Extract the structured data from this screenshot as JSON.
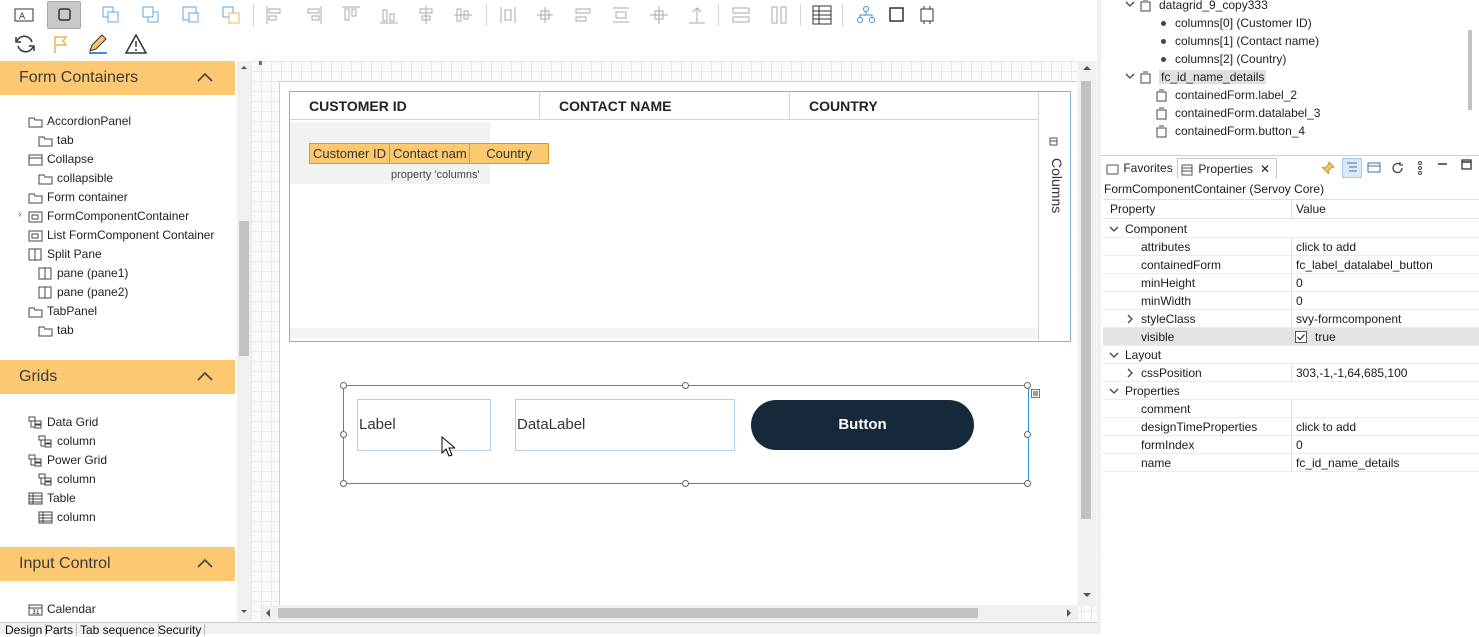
{
  "palette": {
    "categories": [
      {
        "title": "Form Containers",
        "items": [
          {
            "label": "AccordionPanel",
            "icon": "folder-icon",
            "level": 0
          },
          {
            "label": "tab",
            "icon": "folder-icon",
            "level": 1
          },
          {
            "label": "Collapse",
            "icon": "collapse-icon",
            "level": 0
          },
          {
            "label": "collapsible",
            "icon": "folder-icon",
            "level": 1
          },
          {
            "label": "Form container",
            "icon": "folder-icon",
            "level": 0
          },
          {
            "label": "FormComponentContainer",
            "icon": "formcomponent-icon",
            "level": 0
          },
          {
            "label": "List FormComponent Container",
            "icon": "formcomponent-icon",
            "level": 0
          },
          {
            "label": "Split Pane",
            "icon": "splitpane-icon",
            "level": 0
          },
          {
            "label": "pane (pane1)",
            "icon": "splitpane-icon",
            "level": 1
          },
          {
            "label": "pane (pane2)",
            "icon": "splitpane-icon",
            "level": 1
          },
          {
            "label": "TabPanel",
            "icon": "folder-icon",
            "level": 0
          },
          {
            "label": "tab",
            "icon": "folder-icon",
            "level": 1
          }
        ]
      },
      {
        "title": "Grids",
        "items": [
          {
            "label": "Data Grid",
            "icon": "datagrid-icon",
            "level": 0
          },
          {
            "label": "column",
            "icon": "datagrid-icon",
            "level": 1
          },
          {
            "label": "Power Grid",
            "icon": "datagrid-icon",
            "level": 0
          },
          {
            "label": "column",
            "icon": "datagrid-icon",
            "level": 1
          },
          {
            "label": "Table",
            "icon": "table-icon",
            "level": 0
          },
          {
            "label": "column",
            "icon": "table-icon",
            "level": 1
          }
        ]
      },
      {
        "title": "Input Control",
        "items": [
          {
            "label": "Calendar",
            "icon": "calendar-icon",
            "level": 0
          }
        ]
      }
    ]
  },
  "editor": {
    "grid": {
      "columns": [
        "CUSTOMER ID",
        "CONTACT NAME",
        "COUNTRY"
      ],
      "chips": [
        "Customer ID",
        "Contact nam",
        "Country"
      ],
      "property_label": "property 'columns'",
      "side_label": "Columns"
    },
    "form_component": {
      "label": "Label",
      "datalabel": "DataLabel",
      "button": "Button"
    }
  },
  "bottom_tabs": [
    "Design",
    "Parts",
    "Tab sequence",
    "Security"
  ],
  "outline": {
    "items": [
      {
        "label": "datagrid_9_copy333",
        "level": 1,
        "expanded": true,
        "icon": "component-icon"
      },
      {
        "label": "columns[0] (Customer ID)",
        "level": 2,
        "icon": "bullet-icon"
      },
      {
        "label": "columns[1] (Contact name)",
        "level": 2,
        "icon": "bullet-icon"
      },
      {
        "label": "columns[2] (Country)",
        "level": 2,
        "icon": "bullet-icon"
      },
      {
        "label": "fc_id_name_details",
        "level": 1,
        "expanded": true,
        "selected": true,
        "icon": "component-icon"
      },
      {
        "label": "containedForm.label_2",
        "level": 2,
        "icon": "component-icon"
      },
      {
        "label": "containedForm.datalabel_3",
        "level": 2,
        "icon": "component-icon"
      },
      {
        "label": "containedForm.button_4",
        "level": 2,
        "icon": "component-icon"
      }
    ]
  },
  "properties": {
    "tabs": [
      "Favorites",
      "Properties"
    ],
    "subtitle": "FormComponentContainer (Servoy Core)",
    "header": {
      "key": "Property",
      "value": "Value"
    },
    "rows": [
      {
        "key": "Component",
        "value": "",
        "group": true
      },
      {
        "key": "attributes",
        "value": "click to add"
      },
      {
        "key": "containedForm",
        "value": "fc_label_datalabel_button"
      },
      {
        "key": "minHeight",
        "value": "0"
      },
      {
        "key": "minWidth",
        "value": "0"
      },
      {
        "key": "styleClass",
        "value": "svy-formcomponent",
        "expandable": true
      },
      {
        "key": "visible",
        "value": "true",
        "checkbox": true,
        "highlight": true
      },
      {
        "key": "Layout",
        "value": "",
        "group": true
      },
      {
        "key": "cssPosition",
        "value": "303,-1,-1,64,685,100",
        "expandable": true
      },
      {
        "key": "Properties",
        "value": "",
        "group": true
      },
      {
        "key": "comment",
        "value": ""
      },
      {
        "key": "designTimeProperties",
        "value": "click to add"
      },
      {
        "key": "formIndex",
        "value": "0"
      },
      {
        "key": "name",
        "value": "fc_id_name_details"
      }
    ]
  },
  "colors": {
    "category_header": "#fcc871",
    "selection_border": "#2f8fdc",
    "button_bg": "#16293a",
    "chip_bg": "#fbc96f"
  }
}
